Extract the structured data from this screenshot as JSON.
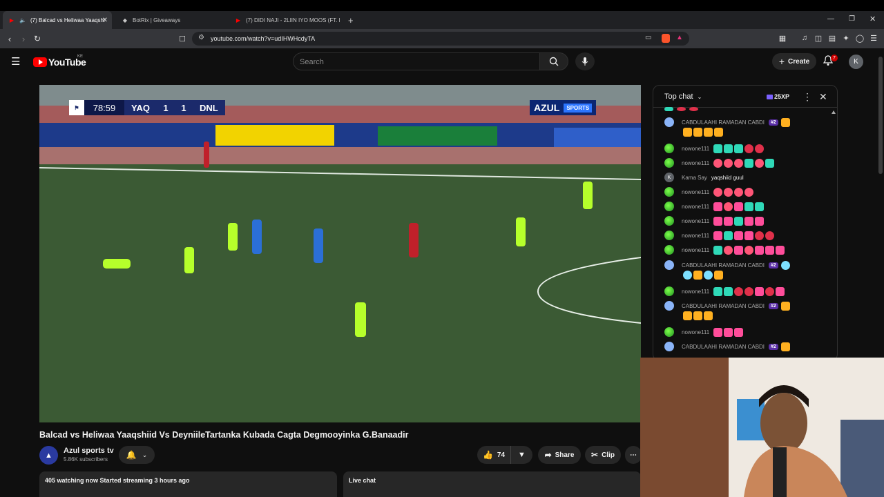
{
  "browser": {
    "tabs": [
      {
        "label": "(7) Balcad vs Heliwaa Yaaqshi",
        "active": true
      },
      {
        "label": "BotRix | Giveaways",
        "active": false
      },
      {
        "label": "(7) DIDI NAJI - 2LIIN IYO MOOS (FT. L",
        "active": false
      }
    ],
    "new_tab": "+",
    "url": "youtube.com/watch?v=udIHWHcdyTA"
  },
  "youtube": {
    "logo_text": "YouTube",
    "country_code": "KE",
    "search_placeholder": "Search",
    "create_label": "Create",
    "notification_count": "7",
    "avatar_letter": "K"
  },
  "video": {
    "scorebug": {
      "time": "78:59",
      "home": "YAQ",
      "home_score": "1",
      "away_score": "1",
      "away": "DNL"
    },
    "broadcaster": {
      "name": "AZUL",
      "sub": "SPORTS"
    },
    "title": "Balcad vs Heliwaa Yaaqshiid Vs DeyniileTartanka Kubada Cagta Degmooyinka G.Banaadir",
    "channel": {
      "name": "Azul sports tv",
      "subscribers": "5.86K subscribers"
    },
    "likes": "74",
    "share_label": "Share",
    "clip_label": "Clip",
    "more_label": "⋯",
    "info_text": "405 watching now  Started streaming 3 hours ago",
    "live_chat_label": "Live chat"
  },
  "chat": {
    "header": "Top chat",
    "xp": "25XP",
    "messages": [
      {
        "name": "CABDULAAHI RAMADAN CABDI",
        "badge": "#2",
        "avatar": "#8ab4f8",
        "text": ""
      },
      {
        "name": "nowone111",
        "badge": "",
        "avatar": "leaf",
        "text": ""
      },
      {
        "name": "nowone111",
        "badge": "",
        "avatar": "leaf",
        "text": ""
      },
      {
        "name": "Kama Say",
        "badge": "",
        "avatar": "#5f6368",
        "text": "yaqshiid guul"
      },
      {
        "name": "nowone111",
        "badge": "",
        "avatar": "leaf",
        "text": ""
      },
      {
        "name": "nowone111",
        "badge": "",
        "avatar": "leaf",
        "text": ""
      },
      {
        "name": "nowone111",
        "badge": "",
        "avatar": "leaf",
        "text": ""
      },
      {
        "name": "nowone111",
        "badge": "",
        "avatar": "leaf",
        "text": ""
      },
      {
        "name": "nowone111",
        "badge": "",
        "avatar": "leaf",
        "text": ""
      },
      {
        "name": "CABDULAAHI RAMADAN CABDI",
        "badge": "#2",
        "avatar": "#8ab4f8",
        "text": ""
      },
      {
        "name": "nowone111",
        "badge": "",
        "avatar": "leaf",
        "text": ""
      },
      {
        "name": "CABDULAAHI RAMADAN CABDI",
        "badge": "#2",
        "avatar": "#8ab4f8",
        "text": ""
      },
      {
        "name": "nowone111",
        "badge": "",
        "avatar": "leaf",
        "text": ""
      },
      {
        "name": "CABDULAAHI RAMADAN CABDI",
        "badge": "#2",
        "avatar": "#8ab4f8",
        "text": ""
      }
    ],
    "avatar_letter_kama": "K"
  }
}
